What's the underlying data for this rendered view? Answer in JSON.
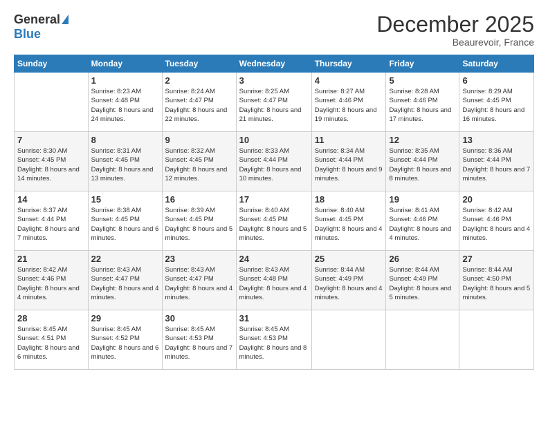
{
  "header": {
    "logo_general": "General",
    "logo_blue": "Blue",
    "month_title": "December 2025",
    "location": "Beaurevoir, France"
  },
  "weekdays": [
    "Sunday",
    "Monday",
    "Tuesday",
    "Wednesday",
    "Thursday",
    "Friday",
    "Saturday"
  ],
  "weeks": [
    [
      {
        "day": "",
        "sunrise": "",
        "sunset": "",
        "daylight": ""
      },
      {
        "day": "1",
        "sunrise": "Sunrise: 8:23 AM",
        "sunset": "Sunset: 4:48 PM",
        "daylight": "Daylight: 8 hours and 24 minutes."
      },
      {
        "day": "2",
        "sunrise": "Sunrise: 8:24 AM",
        "sunset": "Sunset: 4:47 PM",
        "daylight": "Daylight: 8 hours and 22 minutes."
      },
      {
        "day": "3",
        "sunrise": "Sunrise: 8:25 AM",
        "sunset": "Sunset: 4:47 PM",
        "daylight": "Daylight: 8 hours and 21 minutes."
      },
      {
        "day": "4",
        "sunrise": "Sunrise: 8:27 AM",
        "sunset": "Sunset: 4:46 PM",
        "daylight": "Daylight: 8 hours and 19 minutes."
      },
      {
        "day": "5",
        "sunrise": "Sunrise: 8:28 AM",
        "sunset": "Sunset: 4:46 PM",
        "daylight": "Daylight: 8 hours and 17 minutes."
      },
      {
        "day": "6",
        "sunrise": "Sunrise: 8:29 AM",
        "sunset": "Sunset: 4:45 PM",
        "daylight": "Daylight: 8 hours and 16 minutes."
      }
    ],
    [
      {
        "day": "7",
        "sunrise": "Sunrise: 8:30 AM",
        "sunset": "Sunset: 4:45 PM",
        "daylight": "Daylight: 8 hours and 14 minutes."
      },
      {
        "day": "8",
        "sunrise": "Sunrise: 8:31 AM",
        "sunset": "Sunset: 4:45 PM",
        "daylight": "Daylight: 8 hours and 13 minutes."
      },
      {
        "day": "9",
        "sunrise": "Sunrise: 8:32 AM",
        "sunset": "Sunset: 4:45 PM",
        "daylight": "Daylight: 8 hours and 12 minutes."
      },
      {
        "day": "10",
        "sunrise": "Sunrise: 8:33 AM",
        "sunset": "Sunset: 4:44 PM",
        "daylight": "Daylight: 8 hours and 10 minutes."
      },
      {
        "day": "11",
        "sunrise": "Sunrise: 8:34 AM",
        "sunset": "Sunset: 4:44 PM",
        "daylight": "Daylight: 8 hours and 9 minutes."
      },
      {
        "day": "12",
        "sunrise": "Sunrise: 8:35 AM",
        "sunset": "Sunset: 4:44 PM",
        "daylight": "Daylight: 8 hours and 8 minutes."
      },
      {
        "day": "13",
        "sunrise": "Sunrise: 8:36 AM",
        "sunset": "Sunset: 4:44 PM",
        "daylight": "Daylight: 8 hours and 7 minutes."
      }
    ],
    [
      {
        "day": "14",
        "sunrise": "Sunrise: 8:37 AM",
        "sunset": "Sunset: 4:44 PM",
        "daylight": "Daylight: 8 hours and 7 minutes."
      },
      {
        "day": "15",
        "sunrise": "Sunrise: 8:38 AM",
        "sunset": "Sunset: 4:45 PM",
        "daylight": "Daylight: 8 hours and 6 minutes."
      },
      {
        "day": "16",
        "sunrise": "Sunrise: 8:39 AM",
        "sunset": "Sunset: 4:45 PM",
        "daylight": "Daylight: 8 hours and 5 minutes."
      },
      {
        "day": "17",
        "sunrise": "Sunrise: 8:40 AM",
        "sunset": "Sunset: 4:45 PM",
        "daylight": "Daylight: 8 hours and 5 minutes."
      },
      {
        "day": "18",
        "sunrise": "Sunrise: 8:40 AM",
        "sunset": "Sunset: 4:45 PM",
        "daylight": "Daylight: 8 hours and 4 minutes."
      },
      {
        "day": "19",
        "sunrise": "Sunrise: 8:41 AM",
        "sunset": "Sunset: 4:46 PM",
        "daylight": "Daylight: 8 hours and 4 minutes."
      },
      {
        "day": "20",
        "sunrise": "Sunrise: 8:42 AM",
        "sunset": "Sunset: 4:46 PM",
        "daylight": "Daylight: 8 hours and 4 minutes."
      }
    ],
    [
      {
        "day": "21",
        "sunrise": "Sunrise: 8:42 AM",
        "sunset": "Sunset: 4:46 PM",
        "daylight": "Daylight: 8 hours and 4 minutes."
      },
      {
        "day": "22",
        "sunrise": "Sunrise: 8:43 AM",
        "sunset": "Sunset: 4:47 PM",
        "daylight": "Daylight: 8 hours and 4 minutes."
      },
      {
        "day": "23",
        "sunrise": "Sunrise: 8:43 AM",
        "sunset": "Sunset: 4:47 PM",
        "daylight": "Daylight: 8 hours and 4 minutes."
      },
      {
        "day": "24",
        "sunrise": "Sunrise: 8:43 AM",
        "sunset": "Sunset: 4:48 PM",
        "daylight": "Daylight: 8 hours and 4 minutes."
      },
      {
        "day": "25",
        "sunrise": "Sunrise: 8:44 AM",
        "sunset": "Sunset: 4:49 PM",
        "daylight": "Daylight: 8 hours and 4 minutes."
      },
      {
        "day": "26",
        "sunrise": "Sunrise: 8:44 AM",
        "sunset": "Sunset: 4:49 PM",
        "daylight": "Daylight: 8 hours and 5 minutes."
      },
      {
        "day": "27",
        "sunrise": "Sunrise: 8:44 AM",
        "sunset": "Sunset: 4:50 PM",
        "daylight": "Daylight: 8 hours and 5 minutes."
      }
    ],
    [
      {
        "day": "28",
        "sunrise": "Sunrise: 8:45 AM",
        "sunset": "Sunset: 4:51 PM",
        "daylight": "Daylight: 8 hours and 6 minutes."
      },
      {
        "day": "29",
        "sunrise": "Sunrise: 8:45 AM",
        "sunset": "Sunset: 4:52 PM",
        "daylight": "Daylight: 8 hours and 6 minutes."
      },
      {
        "day": "30",
        "sunrise": "Sunrise: 8:45 AM",
        "sunset": "Sunset: 4:53 PM",
        "daylight": "Daylight: 8 hours and 7 minutes."
      },
      {
        "day": "31",
        "sunrise": "Sunrise: 8:45 AM",
        "sunset": "Sunset: 4:53 PM",
        "daylight": "Daylight: 8 hours and 8 minutes."
      },
      {
        "day": "",
        "sunrise": "",
        "sunset": "",
        "daylight": ""
      },
      {
        "day": "",
        "sunrise": "",
        "sunset": "",
        "daylight": ""
      },
      {
        "day": "",
        "sunrise": "",
        "sunset": "",
        "daylight": ""
      }
    ]
  ]
}
